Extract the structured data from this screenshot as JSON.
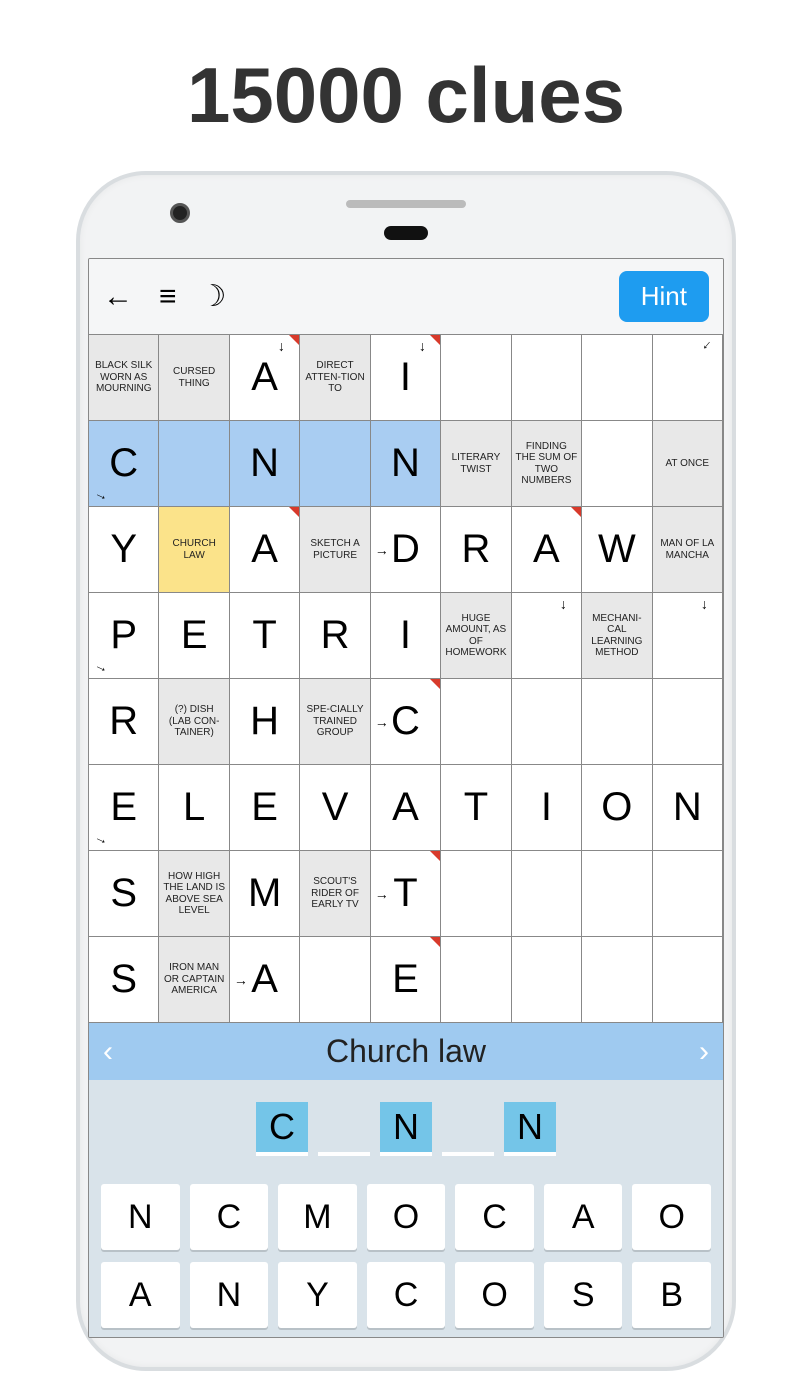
{
  "headline": "15000 clues",
  "toolbar": {
    "hint_label": "Hint"
  },
  "grid": [
    [
      {
        "t": "clue",
        "txt": "BLACK SILK WORN AS MOURNING"
      },
      {
        "t": "clue",
        "txt": "CURSED THING"
      },
      {
        "t": "letter",
        "txt": "A",
        "red": true,
        "ad": true
      },
      {
        "t": "clue",
        "txt": "DIRECT ATTEN-TION TO"
      },
      {
        "t": "letter",
        "txt": "I",
        "red": true,
        "ad": true
      },
      {
        "t": "empty"
      },
      {
        "t": "empty"
      },
      {
        "t": "empty"
      },
      {
        "t": "empty",
        "adl": true
      }
    ],
    [
      {
        "t": "letter",
        "txt": "C",
        "hl": true,
        "adr": true
      },
      {
        "t": "letter",
        "txt": "",
        "hl": true
      },
      {
        "t": "letter",
        "txt": "N",
        "hl": true
      },
      {
        "t": "letter",
        "txt": "",
        "hl": true
      },
      {
        "t": "letter",
        "txt": "N",
        "hl": true
      },
      {
        "t": "clue",
        "txt": "LITERARY TWIST"
      },
      {
        "t": "clue",
        "txt": "FINDING THE SUM OF TWO NUMBERS"
      },
      {
        "t": "empty"
      },
      {
        "t": "clue",
        "txt": "AT ONCE"
      }
    ],
    [
      {
        "t": "letter",
        "txt": "Y"
      },
      {
        "t": "clue",
        "txt": "CHURCH LAW",
        "active": true
      },
      {
        "t": "letter",
        "txt": "A",
        "red": true
      },
      {
        "t": "clue",
        "txt": "SKETCH A PICTURE"
      },
      {
        "t": "letter",
        "txt": "D",
        "ar": true
      },
      {
        "t": "letter",
        "txt": "R"
      },
      {
        "t": "letter",
        "txt": "A",
        "red": true
      },
      {
        "t": "letter",
        "txt": "W"
      },
      {
        "t": "clue",
        "txt": "MAN OF LA MANCHA"
      }
    ],
    [
      {
        "t": "letter",
        "txt": "P",
        "adr": true
      },
      {
        "t": "letter",
        "txt": "E"
      },
      {
        "t": "letter",
        "txt": "T"
      },
      {
        "t": "letter",
        "txt": "R"
      },
      {
        "t": "letter",
        "txt": "I"
      },
      {
        "t": "clue",
        "txt": "HUGE AMOUNT, AS OF HOMEWORK"
      },
      {
        "t": "empty",
        "ad": true
      },
      {
        "t": "clue",
        "txt": "MECHANI-CAL LEARNING METHOD"
      },
      {
        "t": "empty",
        "ad": true
      }
    ],
    [
      {
        "t": "letter",
        "txt": "R"
      },
      {
        "t": "clue",
        "txt": "(?) DISH (LAB CON-TAINER)"
      },
      {
        "t": "letter",
        "txt": "H"
      },
      {
        "t": "clue",
        "txt": "SPE-CIALLY TRAINED GROUP"
      },
      {
        "t": "letter",
        "txt": "C",
        "red": true,
        "ar": true
      },
      {
        "t": "empty"
      },
      {
        "t": "empty"
      },
      {
        "t": "empty"
      },
      {
        "t": "empty"
      }
    ],
    [
      {
        "t": "letter",
        "txt": "E",
        "adr": true
      },
      {
        "t": "letter",
        "txt": "L"
      },
      {
        "t": "letter",
        "txt": "E"
      },
      {
        "t": "letter",
        "txt": "V"
      },
      {
        "t": "letter",
        "txt": "A"
      },
      {
        "t": "letter",
        "txt": "T"
      },
      {
        "t": "letter",
        "txt": "I"
      },
      {
        "t": "letter",
        "txt": "O"
      },
      {
        "t": "letter",
        "txt": "N"
      }
    ],
    [
      {
        "t": "letter",
        "txt": "S"
      },
      {
        "t": "clue",
        "txt": "HOW HIGH THE LAND IS ABOVE SEA LEVEL"
      },
      {
        "t": "letter",
        "txt": "M"
      },
      {
        "t": "clue",
        "txt": "SCOUT'S RIDER OF EARLY TV"
      },
      {
        "t": "letter",
        "txt": "T",
        "red": true,
        "ar": true
      },
      {
        "t": "empty"
      },
      {
        "t": "empty"
      },
      {
        "t": "empty"
      },
      {
        "t": "empty"
      }
    ],
    [
      {
        "t": "letter",
        "txt": "S"
      },
      {
        "t": "clue",
        "txt": "IRON MAN OR CAPTAIN AMERICA"
      },
      {
        "t": "letter",
        "txt": "A",
        "ar": true
      },
      {
        "t": "empty"
      },
      {
        "t": "letter",
        "txt": "E",
        "red": true
      },
      {
        "t": "empty"
      },
      {
        "t": "empty"
      },
      {
        "t": "empty"
      },
      {
        "t": "empty"
      }
    ]
  ],
  "clue_bar": {
    "text": "Church law"
  },
  "answer_slots": [
    {
      "txt": "C",
      "filled": true
    },
    {
      "txt": "",
      "filled": false
    },
    {
      "txt": "N",
      "filled": true
    },
    {
      "txt": "",
      "filled": false
    },
    {
      "txt": "N",
      "filled": true
    }
  ],
  "keyboard": [
    [
      "N",
      "C",
      "M",
      "O",
      "C",
      "A",
      "O"
    ],
    [
      "A",
      "N",
      "Y",
      "C",
      "O",
      "S",
      "B"
    ]
  ]
}
